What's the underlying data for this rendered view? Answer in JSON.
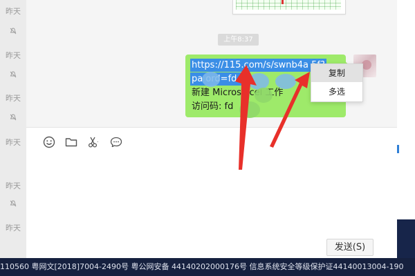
{
  "sidebar": {
    "rows": [
      {
        "label": "昨天",
        "muted": true
      },
      {
        "label": "昨天",
        "muted": true
      },
      {
        "label": "昨天",
        "muted": true
      },
      {
        "label": "昨天",
        "muted": false
      },
      {
        "label": "昨天",
        "muted": true
      },
      {
        "label": "昨天",
        "muted": false
      }
    ]
  },
  "chat": {
    "time_badge": "上午8:37",
    "message": {
      "line1": "https://115.com/s/swnb4a   5f?",
      "line2": "pa   ord=fd   #",
      "line3": "新建 Micros   xcel 工作",
      "line4": "访问码: fd"
    }
  },
  "context_menu": {
    "copy_label": "复制",
    "multi_select_label": "多选"
  },
  "toolbar": {
    "icons": [
      "emoji-icon",
      "folder-icon",
      "scissors-icon",
      "chat-history-icon"
    ],
    "send_label": "发送(S)"
  },
  "footer": {
    "text": "110560  粤网文[2018]7004-2490号  粤公网安备 44140202000176号  信息系统安全等级保护证44140013004-190"
  },
  "colors": {
    "bubble": "#9eea6a",
    "selection": "#3a8ee6",
    "arrow": "#e8302a",
    "footer_bg": "#16213f"
  }
}
